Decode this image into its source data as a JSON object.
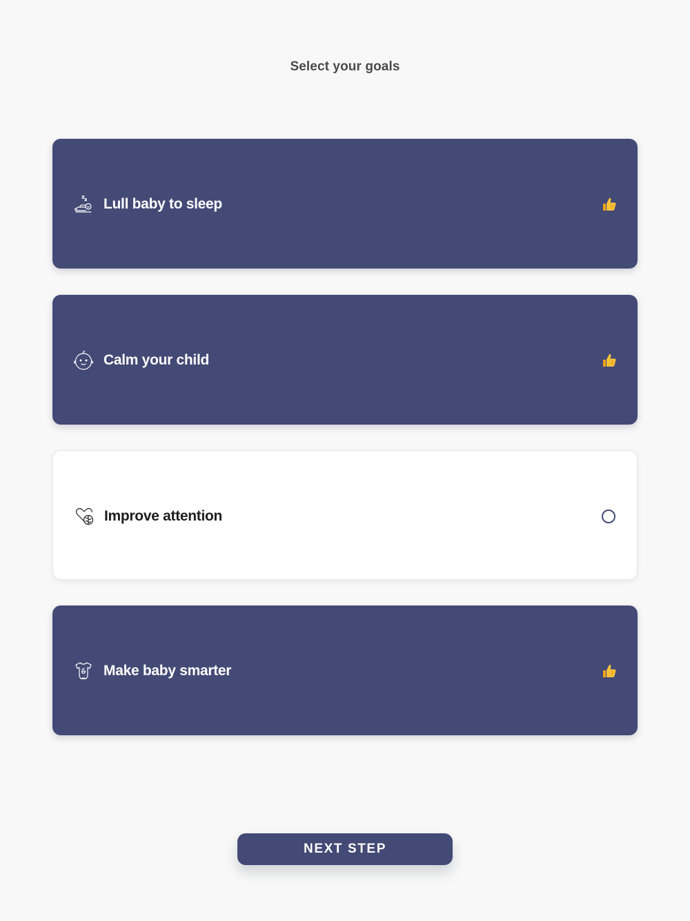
{
  "header": {
    "title": "Select your goals"
  },
  "goals": [
    {
      "label": "Lull baby to sleep",
      "icon": "sleeping-baby-icon",
      "selected": true,
      "status_icon": "thumbs-up-icon"
    },
    {
      "label": "Calm your child",
      "icon": "baby-face-icon",
      "selected": true,
      "status_icon": "thumbs-up-icon"
    },
    {
      "label": "Improve attention",
      "icon": "heart-brain-icon",
      "selected": false,
      "status_icon": "radio-empty-icon"
    },
    {
      "label": "Make baby smarter",
      "icon": "baby-onesie-icon",
      "selected": true,
      "status_icon": "thumbs-up-icon"
    }
  ],
  "footer": {
    "next_label": "NEXT STEP"
  },
  "colors": {
    "accent": "#434a75",
    "background": "#f8f8f8",
    "card_unselected": "#ffffff",
    "thumb": "#f5b82e"
  }
}
